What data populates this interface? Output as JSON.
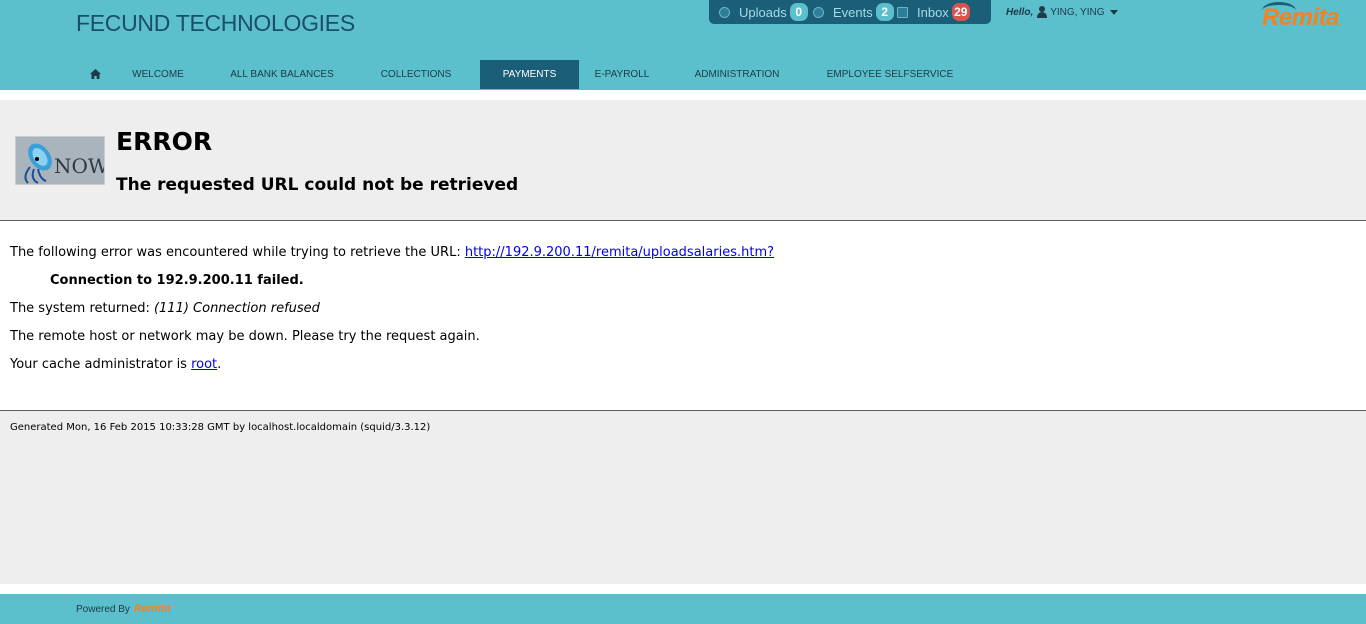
{
  "header": {
    "company": "FECUND TECHNOLOGIES",
    "topbar": {
      "uploads_label": "Uploads",
      "uploads_count": "0",
      "events_label": "Events",
      "events_count": "2",
      "inbox_label": "Inbox",
      "inbox_count": "29"
    },
    "greeting": "Hello,",
    "user": "YING, YING",
    "logo": "Remita"
  },
  "nav": {
    "items": [
      "WELCOME",
      "ALL BANK BALANCES",
      "COLLECTIONS",
      "PAYMENTS",
      "E-PAYROLL",
      "ADMINISTRATION",
      "EMPLOYEE SELFSERVICE"
    ],
    "active": "PAYMENTS"
  },
  "error_page": {
    "heading": "ERROR",
    "subheading": "The requested URL could not be retrieved",
    "intro": "The following error was encountered while trying to retrieve the URL: ",
    "url": "http://192.9.200.11/remita/uploadsalaries.htm?",
    "failure": "Connection to 192.9.200.11 failed.",
    "system_returned_label": "The system returned: ",
    "system_returned_value": "(111) Connection refused",
    "advice": "The remote host or network may be down. Please try the request again.",
    "admin_label": "Your cache administrator is ",
    "admin_link": "root",
    "admin_suffix": ".",
    "generated": "Generated Mon, 16 Feb 2015 10:33:28 GMT by localhost.localdomain (squid/3.3.12)"
  },
  "footer": {
    "powered_by": "Powered By",
    "logo": "Remita"
  },
  "colors": {
    "header_bg": "#5bbfcc",
    "nav_active": "#1b5e78",
    "brand_orange": "#f58220",
    "uploads_badge": "#5bbfcc",
    "inbox_badge": "#d9534f"
  },
  "icons": [
    "home-icon",
    "upload-icon",
    "events-icon",
    "inbox-icon",
    "user-icon",
    "caret-down-icon",
    "squid-now-logo"
  ]
}
